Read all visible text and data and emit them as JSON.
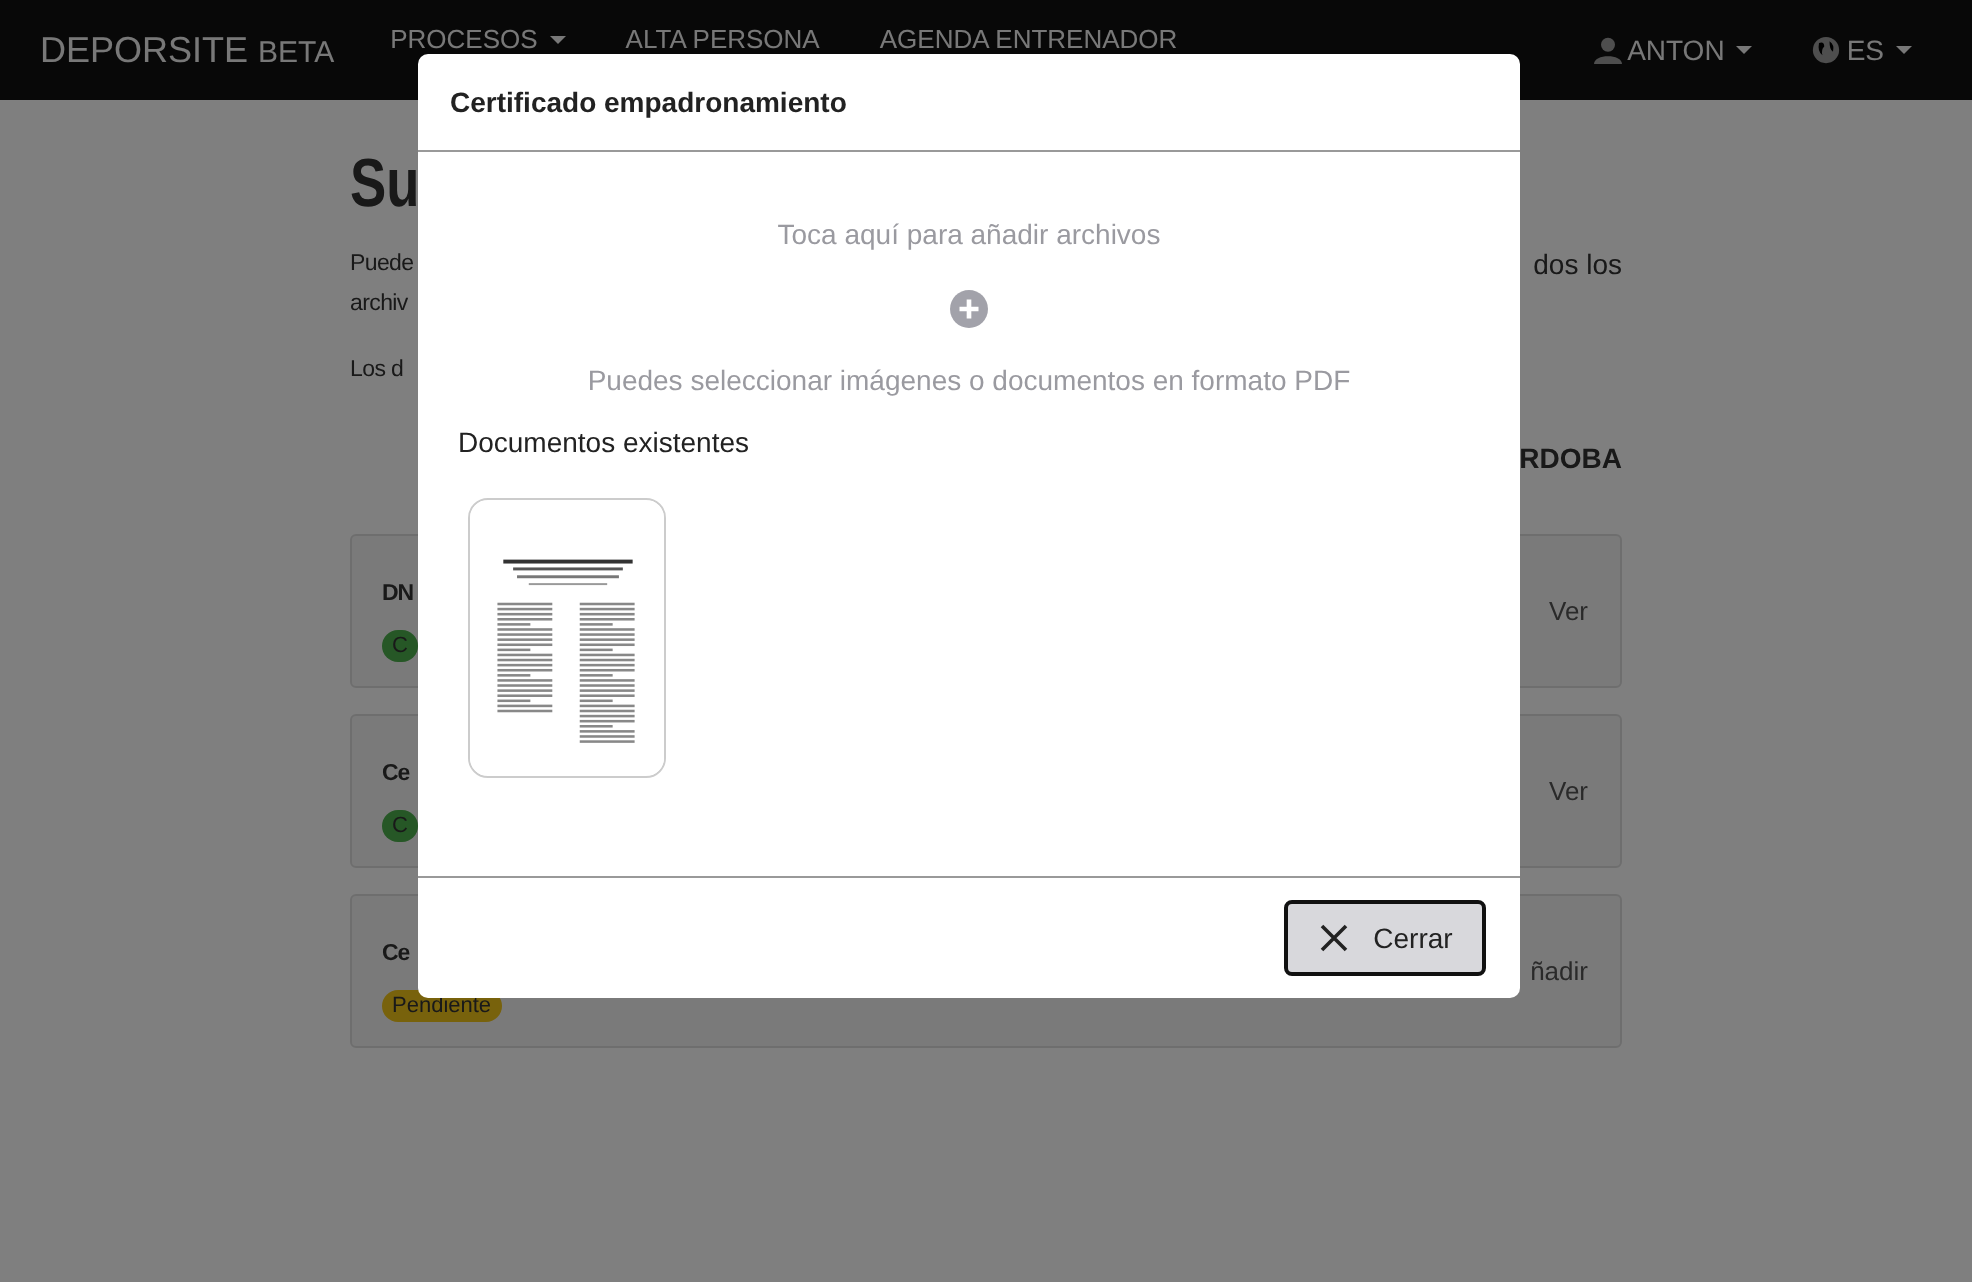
{
  "navbar": {
    "brand": "DEPORSITE",
    "brand_tag": "BETA",
    "menu": [
      {
        "label": "PROCESOS",
        "dropdown": true
      },
      {
        "label": "ALTA PERSONA",
        "dropdown": false
      },
      {
        "label": "AGENDA ENTRENADOR",
        "dropdown": false
      }
    ],
    "user": {
      "label": "ANTON"
    },
    "language": {
      "label": "ES"
    }
  },
  "page": {
    "heading": "Su",
    "intro_left": [
      "Puede",
      "archiv"
    ],
    "intro_right": "dos los",
    "note": "Los d",
    "location": "RDOBA",
    "documents": [
      {
        "title": "DN",
        "status": {
          "label": "C",
          "kind": "done"
        },
        "action": "Ver"
      },
      {
        "title": "Ce",
        "status": {
          "label": "C",
          "kind": "done"
        },
        "action": "Ver"
      },
      {
        "title": "Ce",
        "status": {
          "label": "Pendiente",
          "kind": "pending"
        },
        "action": "ñadir"
      }
    ]
  },
  "modal": {
    "title": "Certificado empadronamiento",
    "dropzone": {
      "prompt": "Toca aquí para añadir archivos",
      "hint": "Puedes seleccionar imágenes o documentos en formato PDF"
    },
    "existing_heading": "Documentos existentes",
    "close_button": "Cerrar"
  }
}
